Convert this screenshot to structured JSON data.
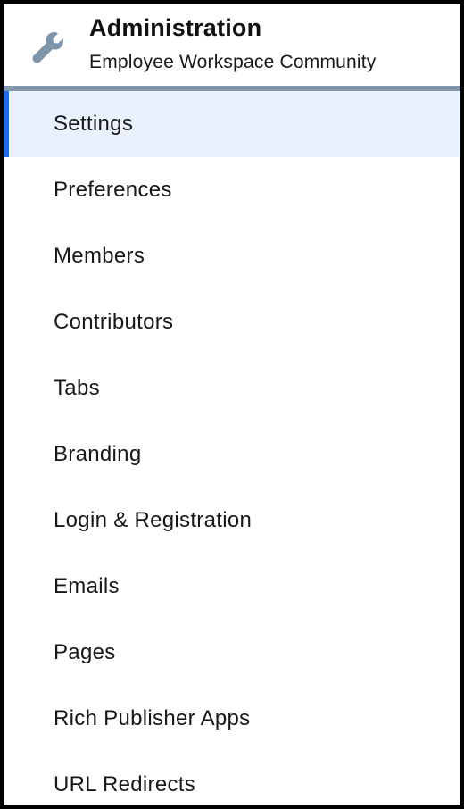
{
  "header": {
    "icon": "wrench-icon",
    "title": "Administration",
    "subtitle": "Employee Workspace Community"
  },
  "colors": {
    "icon": "#7f95ab",
    "divider": "#8396ab",
    "active_background": "#e8f1fd",
    "active_indicator": "#1b6fe0"
  },
  "nav": {
    "active_index": 0,
    "items": [
      {
        "label": "Settings"
      },
      {
        "label": "Preferences"
      },
      {
        "label": "Members"
      },
      {
        "label": "Contributors"
      },
      {
        "label": "Tabs"
      },
      {
        "label": "Branding"
      },
      {
        "label": "Login & Registration"
      },
      {
        "label": "Emails"
      },
      {
        "label": "Pages"
      },
      {
        "label": "Rich Publisher Apps"
      },
      {
        "label": "URL Redirects"
      }
    ]
  }
}
